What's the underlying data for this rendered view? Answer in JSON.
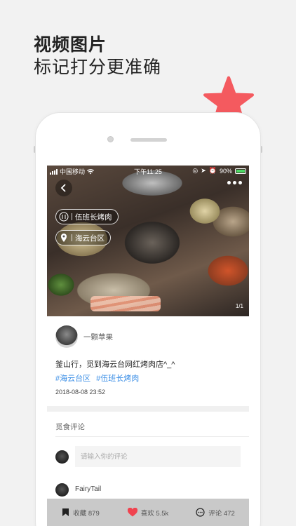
{
  "headline": {
    "line1": "视频图片",
    "line2": "标记打分更准确"
  },
  "status_bar": {
    "carrier": "中国移动",
    "time": "下午11:25",
    "battery": "90%"
  },
  "photo": {
    "tag_restaurant": "伍班长烤肉",
    "tag_location": "海云台区",
    "pager": "1/1"
  },
  "post": {
    "author": "一颗苹果",
    "content": "釜山行，觅到海云台网红烤肉店^_^",
    "hashtags": [
      "#海云台区",
      "#伍班长烤肉"
    ],
    "date": "2018-08-08 23:52"
  },
  "comments": {
    "title": "觅食评论",
    "input_placeholder": "请输入你的评论",
    "first_commenter": "FairyTail"
  },
  "actions": {
    "collect": "收藏 879",
    "like": "喜欢 5.5k",
    "comment": "评论 472"
  },
  "colors": {
    "accent_star": "#f45a5f",
    "hashtag": "#3a8ee6",
    "like": "#f0434f"
  },
  "icons": [
    "star-icon",
    "back-icon",
    "more-icon",
    "restaurant-icon",
    "location-icon",
    "bookmark-icon",
    "heart-icon",
    "comment-icon",
    "wifi-icon"
  ]
}
